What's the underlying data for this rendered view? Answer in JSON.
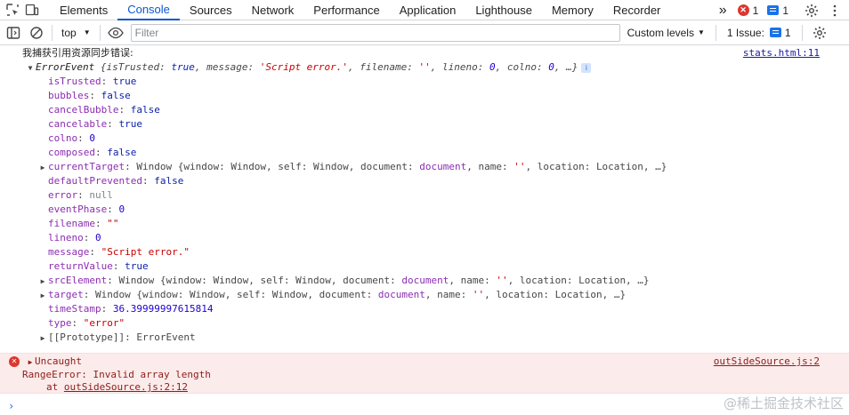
{
  "tabs": [
    "Elements",
    "Console",
    "Sources",
    "Network",
    "Performance",
    "Application",
    "Lighthouse",
    "Memory",
    "Recorder"
  ],
  "active_tab": "Console",
  "more_tabs": "»",
  "error_count": "1",
  "message_count": "1",
  "toolbar": {
    "context": "top",
    "filter_placeholder": "Filter",
    "levels": "Custom levels",
    "issues": "1 Issue:",
    "issues_count": "1"
  },
  "log": {
    "header_text": "我捕获引用资源同步错误:",
    "header_source": "stats.html:11",
    "obj_name": "ErrorEvent",
    "preview": {
      "p1": "{isTrusted: ",
      "v1": "true",
      "p2": ", message: ",
      "v2": "'Script error.'",
      "p3": ", filename: ",
      "v3": "''",
      "p4": ", lineno: ",
      "v4": "0",
      "p5": ", colno: ",
      "v5": "0",
      "p6": ", …}"
    },
    "info_badge": "i",
    "props": [
      {
        "key": "isTrusted",
        "value": "true",
        "type": "bool"
      },
      {
        "key": "bubbles",
        "value": "false",
        "type": "bool"
      },
      {
        "key": "cancelBubble",
        "value": "false",
        "type": "bool"
      },
      {
        "key": "cancelable",
        "value": "true",
        "type": "bool"
      },
      {
        "key": "colno",
        "value": "0",
        "type": "num"
      },
      {
        "key": "composed",
        "value": "false",
        "type": "bool"
      },
      {
        "key": "currentTarget",
        "value": "Window",
        "type": "window",
        "expandable": true
      },
      {
        "key": "defaultPrevented",
        "value": "false",
        "type": "bool"
      },
      {
        "key": "error",
        "value": "null",
        "type": "null"
      },
      {
        "key": "eventPhase",
        "value": "0",
        "type": "num"
      },
      {
        "key": "filename",
        "value": "\"\"",
        "type": "str"
      },
      {
        "key": "lineno",
        "value": "0",
        "type": "num"
      },
      {
        "key": "message",
        "value": "\"Script error.\"",
        "type": "str"
      },
      {
        "key": "returnValue",
        "value": "true",
        "type": "bool"
      },
      {
        "key": "srcElement",
        "value": "Window",
        "type": "window",
        "expandable": true
      },
      {
        "key": "target",
        "value": "Window",
        "type": "window",
        "expandable": true
      },
      {
        "key": "timeStamp",
        "value": "36.39999997615814",
        "type": "num"
      },
      {
        "key": "type",
        "value": "\"error\"",
        "type": "str"
      },
      {
        "key": "[[Prototype]]",
        "value": "ErrorEvent",
        "type": "proto",
        "expandable": true
      }
    ],
    "window_preview": {
      "p1": "{window: Window, self: Window, document: ",
      "doc": "document",
      "p2": ", name: ",
      "name": "''",
      "p3": ", location: Location, …}"
    }
  },
  "error": {
    "title": "Uncaught",
    "source": "outSideSource.js:2",
    "message": "RangeError: Invalid array length",
    "at_prefix": "at ",
    "at_link": "outSideSource.js:2:12"
  },
  "prompt": "›",
  "watermark": "@稀土掘金技术社区"
}
